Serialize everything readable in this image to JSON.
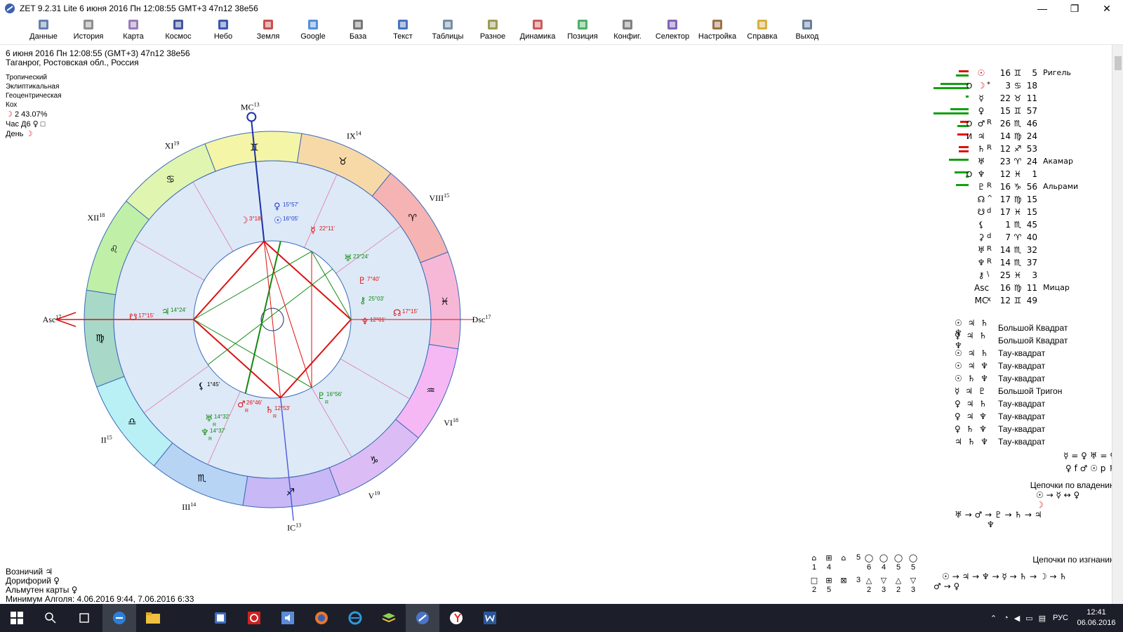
{
  "window": {
    "title": "ZET 9.2.31 Lite    6 июня 2016  Пн  12:08:55 GMT+3  47n12  38e56",
    "min": "—",
    "max": "❐",
    "close": "✕"
  },
  "toolbar": [
    {
      "label": "Данные",
      "icon": "data-icon"
    },
    {
      "label": "История",
      "icon": "history-icon"
    },
    {
      "label": "Карта",
      "icon": "map-icon"
    },
    {
      "label": "Космос",
      "icon": "cosmos-icon"
    },
    {
      "label": "Небо",
      "icon": "sky-icon"
    },
    {
      "label": "Земля",
      "icon": "earth-icon"
    },
    {
      "label": "Google",
      "icon": "google-icon"
    },
    {
      "label": "База",
      "icon": "base-icon"
    },
    {
      "label": "Текст",
      "icon": "text-icon"
    },
    {
      "label": "Таблицы",
      "icon": "tables-icon"
    },
    {
      "label": "Разное",
      "icon": "misc-icon"
    },
    {
      "label": "Динамика",
      "icon": "dynamics-icon"
    },
    {
      "label": "Позиция",
      "icon": "position-icon"
    },
    {
      "label": "Конфиг.",
      "icon": "config-icon"
    },
    {
      "label": "Селектор",
      "icon": "selector-icon"
    },
    {
      "label": "Настройка",
      "icon": "settings-icon"
    },
    {
      "label": "Справка",
      "icon": "help-icon"
    },
    {
      "label": "Выход",
      "icon": "exit-icon"
    }
  ],
  "header": {
    "line1": "6 июня 2016  Пн  12:08:55 (GMT+3) 47n12  38e56",
    "line2": "Таганрог, Ростовская обл., Россия"
  },
  "params": {
    "zodiac": "Тропический",
    "coords": "Эклиптикальная",
    "center": "Геоцентрическая",
    "houses": "Кох",
    "moon_phase_glyph": "☽",
    "moon_phase": "2 43.07%",
    "hour_label": "Час Д6",
    "hour_glyph": "♀",
    "hour_aspect": "□",
    "day_label": "День",
    "day_glyph": "☽"
  },
  "chart": {
    "signs": [
      "♊",
      "♉",
      "♈",
      "♓",
      "♒",
      "♑",
      "♐",
      "♏",
      "♎",
      "♍",
      "♌",
      "♋"
    ],
    "houses": [
      {
        "label": "MC",
        "sup": "13"
      },
      {
        "label": "IX",
        "sup": "14"
      },
      {
        "label": "VIII",
        "sup": "15"
      },
      {
        "label": "Dsc",
        "sup": "17"
      },
      {
        "label": "VI",
        "sup": "18"
      },
      {
        "label": "V",
        "sup": "19"
      },
      {
        "label": "IC",
        "sup": "13"
      },
      {
        "label": "III",
        "sup": "14"
      },
      {
        "label": "II",
        "sup": "15"
      },
      {
        "label": "Asc",
        "sup": "17"
      },
      {
        "label": "XII",
        "sup": "18"
      },
      {
        "label": "XI",
        "sup": "19"
      }
    ],
    "planets": [
      {
        "glyph": "♀",
        "deg": "15°57'",
        "color": "#1e3ccc",
        "retro": ""
      },
      {
        "glyph": "☉",
        "deg": "16°05'",
        "color": "#1e3ccc",
        "retro": ""
      },
      {
        "glyph": "☽",
        "deg": "3°18'",
        "color": "#dd1111",
        "retro": ""
      },
      {
        "glyph": "☿",
        "deg": "22°11'",
        "color": "#dd1111",
        "retro": ""
      },
      {
        "glyph": "♅",
        "deg": "23°24'",
        "color": "#128a12",
        "retro": ""
      },
      {
        "glyph": "♇",
        "deg": "7°40'",
        "color": "#dd1111",
        "retro": ""
      },
      {
        "glyph": "⚷",
        "deg": "25°03'",
        "color": "#128a12",
        "retro": ""
      },
      {
        "glyph": "☊",
        "deg": "17°15'",
        "color": "#dd1111",
        "retro": ""
      },
      {
        "glyph": "♆",
        "deg": "12°01'",
        "color": "#dd1111",
        "retro": ""
      },
      {
        "glyph": "♄",
        "deg": "12°53'",
        "color": "#dd1111",
        "retro": "R"
      },
      {
        "glyph": "♂",
        "deg": "26°46'",
        "color": "#dd1111",
        "retro": "R"
      },
      {
        "glyph": "♇",
        "deg": "16°56'",
        "color": "#128a12",
        "retro": "R"
      },
      {
        "glyph": "☋",
        "deg": "17°15'",
        "color": "#dd1111",
        "retro": ""
      },
      {
        "glyph": "♃",
        "deg": "14°24'",
        "color": "#128a12",
        "retro": ""
      },
      {
        "glyph": "⚸",
        "deg": "1°45'",
        "color": "#000000",
        "retro": ""
      },
      {
        "glyph": "♅",
        "deg": "14°32'",
        "color": "#128a12",
        "retro": "R"
      },
      {
        "glyph": "♆",
        "deg": "14°37'",
        "color": "#128a12",
        "retro": "R"
      }
    ]
  },
  "planet_table": [
    {
      "bars": [
        [
          "#dd1111",
          14
        ],
        [
          "#12a012",
          18
        ]
      ],
      "flag": "",
      "sym": "☉",
      "aspect": "",
      "deg": "16",
      "sign": "♊",
      "min": "5",
      "star": "Ригель",
      "symcolor": "#dd1111"
    },
    {
      "bars": [
        [
          "#12a012",
          40
        ],
        [
          "#12a012",
          50
        ]
      ],
      "flag": "O",
      "sym": "☽",
      "aspect": "*",
      "deg": "3",
      "sign": "♋",
      "min": "18",
      "star": "",
      "symcolor": "#dd1111"
    },
    {
      "bars": [
        [
          "#12a012",
          4
        ]
      ],
      "flag": "",
      "sym": "☿",
      "aspect": "",
      "deg": "22",
      "sign": "♉",
      "min": "11",
      "star": "",
      "symcolor": "#000"
    },
    {
      "bars": [
        [
          "#12a012",
          26
        ],
        [
          "#12a012",
          50
        ]
      ],
      "flag": "",
      "sym": "♀",
      "aspect": "",
      "deg": "15",
      "sign": "♊",
      "min": "57",
      "star": "",
      "symcolor": "#000"
    },
    {
      "bars": [
        [
          "#dd1111",
          12
        ],
        [
          "#12a012",
          16
        ]
      ],
      "flag": "O",
      "sym": "♂",
      "aspect": "R",
      "deg": "26",
      "sign": "♏",
      "min": "46",
      "star": "",
      "symcolor": "#000"
    },
    {
      "bars": [
        [
          "#dd1111",
          16
        ]
      ],
      "flag": "И",
      "sym": "♃",
      "aspect": "",
      "deg": "14",
      "sign": "♍",
      "min": "24",
      "star": "",
      "symcolor": "#000"
    },
    {
      "bars": [
        [
          "#dd1111",
          14
        ],
        [
          "#dd1111",
          14
        ]
      ],
      "flag": "",
      "sym": "♄",
      "aspect": "R",
      "deg": "12",
      "sign": "♐",
      "min": "53",
      "star": "",
      "symcolor": "#000"
    },
    {
      "bars": [
        [
          "#12a012",
          28
        ]
      ],
      "flag": "",
      "sym": "♅",
      "aspect": "",
      "deg": "23",
      "sign": "♈",
      "min": "24",
      "star": "Акамар",
      "symcolor": "#000"
    },
    {
      "bars": [
        [
          "#12a012",
          20
        ],
        [
          "#12a012",
          4
        ]
      ],
      "flag": "O",
      "sym": "♆",
      "aspect": "",
      "deg": "12",
      "sign": "♓",
      "min": "1",
      "star": "",
      "symcolor": "#000"
    },
    {
      "bars": [
        [
          "#12a012",
          18
        ]
      ],
      "flag": "",
      "sym": "♇",
      "aspect": "R",
      "deg": "16",
      "sign": "♑",
      "min": "56",
      "star": "Альрами",
      "symcolor": "#000"
    },
    {
      "bars": [],
      "flag": "",
      "sym": "☊",
      "aspect": "^",
      "deg": "17",
      "sign": "♍",
      "min": "15",
      "star": "",
      "symcolor": "#000"
    },
    {
      "bars": [],
      "flag": "",
      "sym": "☋",
      "aspect": "d",
      "deg": "17",
      "sign": "♓",
      "min": "15",
      "star": "",
      "symcolor": "#000"
    },
    {
      "bars": [],
      "flag": "",
      "sym": "⚸",
      "aspect": "",
      "deg": "1",
      "sign": "♏",
      "min": "45",
      "star": "",
      "symcolor": "#000"
    },
    {
      "bars": [],
      "flag": "",
      "sym": "⚳",
      "aspect": "d",
      "deg": "7",
      "sign": "♈",
      "min": "40",
      "star": "",
      "symcolor": "#000"
    },
    {
      "bars": [],
      "flag": "",
      "sym": "♅",
      "aspect": "R",
      "deg": "14",
      "sign": "♏",
      "min": "32",
      "star": "",
      "symcolor": "#000"
    },
    {
      "bars": [],
      "flag": "",
      "sym": "♆",
      "aspect": "R",
      "deg": "14",
      "sign": "♏",
      "min": "37",
      "star": "",
      "symcolor": "#000"
    },
    {
      "bars": [],
      "flag": "",
      "sym": "⚷",
      "aspect": "\\",
      "deg": "25",
      "sign": "♓",
      "min": "3",
      "star": "",
      "symcolor": "#000"
    },
    {
      "bars": [],
      "flag": "",
      "sym": "Asc",
      "aspect": "",
      "deg": "16",
      "sign": "♍",
      "min": "11",
      "star": "Мицар",
      "symcolor": "#000"
    },
    {
      "bars": [],
      "flag": "",
      "sym": "MC",
      "aspect": "x",
      "deg": "12",
      "sign": "♊",
      "min": "49",
      "star": "",
      "symcolor": "#000"
    }
  ],
  "configurations": [
    {
      "glyphs": "☉ ♃ ♄ ♆",
      "name": "Большой Квадрат"
    },
    {
      "glyphs": "♀ ♃ ♄ ♆",
      "name": "Большой Квадрат"
    },
    {
      "glyphs": "☉ ♃ ♄",
      "name": "Тау-квадрат"
    },
    {
      "glyphs": "☉ ♃ ♆",
      "name": "Тау-квадрат"
    },
    {
      "glyphs": "☉ ♄ ♆",
      "name": "Тау-квадрат"
    },
    {
      "glyphs": "☿ ♃ ♇",
      "name": "Большой Тригон"
    },
    {
      "glyphs": "♀ ♃ ♄",
      "name": "Тау-квадрат"
    },
    {
      "glyphs": "♀ ♃ ♆",
      "name": "Тау-квадрат"
    },
    {
      "glyphs": "♀ ♄ ♆",
      "name": "Тау-квадрат"
    },
    {
      "glyphs": "♃ ♄ ♆",
      "name": "Тау-квадрат"
    }
  ],
  "rules": {
    "line1": "☿ = ♀  ♅ = ♀",
    "line2": "♀ f ♂ ☉ p ♄"
  },
  "chains": {
    "rulership_title": "Цепочки по владению",
    "rulership_1": "☉ → ☿ ↔ ♀",
    "rulership_2": "☽",
    "rulership_3": "♅ → ♂ → ♇ → ♄ → ♃",
    "rulership_4": "♆",
    "exile_title": "Цепочки по изгнанию",
    "exile_1": "☉ → ♃ → ♆ → ☿ → ♄ → ☽ → ♄",
    "exile_2": "♂ → ♀"
  },
  "counts": {
    "top_left_nums": [
      "5",
      "1",
      "4"
    ],
    "top_right_nums": [
      "6",
      "4",
      "5",
      "5"
    ],
    "bottom_left_nums": [
      "3",
      "2",
      "5"
    ],
    "bottom_right_nums": [
      "2",
      "3",
      "2",
      "3"
    ]
  },
  "bottom_info": {
    "vozn": "Возничий",
    "vozn_glyph": "♃",
    "dorif": "Дорифорий",
    "dorif_glyph": "♀",
    "almuten": "Альмутен карты",
    "almuten_glyph": "♀",
    "algol": "Минимум Алголя: 4.06.2016  9:44,  7.06.2016  6:33"
  },
  "taskbar": {
    "lang": "РУС",
    "time": "12:41",
    "date": "06.06.2016"
  }
}
